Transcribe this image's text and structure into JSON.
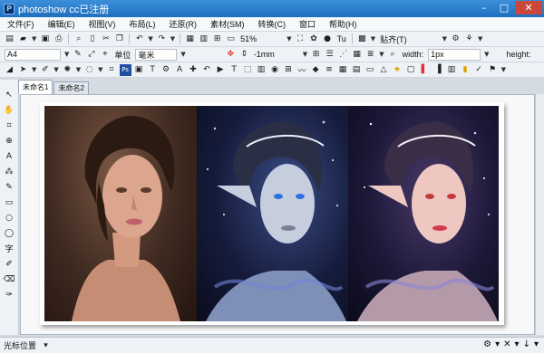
{
  "window": {
    "title": "photoshow cc已注册"
  },
  "menu": [
    "文件(F)",
    "编辑(E)",
    "视图(V)",
    "布局(L)",
    "还原(R)",
    "素材(SM)",
    "转换(C)",
    "窗口",
    "帮助(H)"
  ],
  "toolbar1": {
    "zoom": "51%",
    "align_label": "贴齐(T)"
  },
  "toolbar2": {
    "paper": "A4",
    "unit_label": "单位",
    "unit_value": "毫米",
    "offset_value": "-1mm",
    "width_label": "width:",
    "width_value": "1px",
    "height_label": "height:"
  },
  "tabs": [
    "未命名1",
    "未命名2"
  ],
  "status": {
    "label": "光标位置"
  },
  "accent": "#1f6fc0"
}
